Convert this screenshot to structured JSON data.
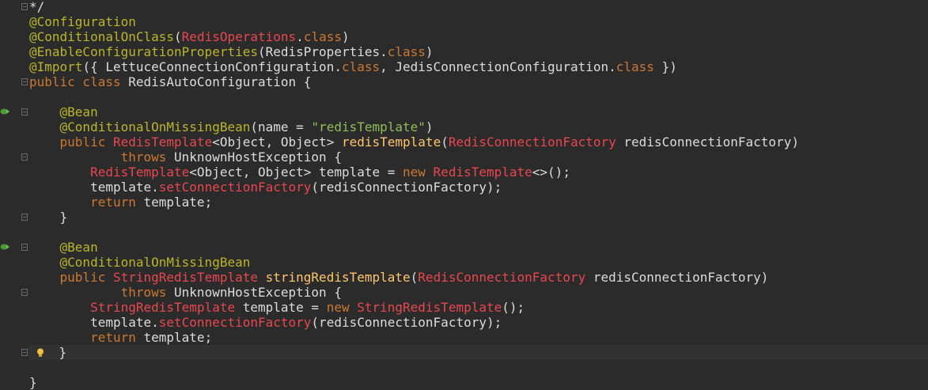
{
  "editor": {
    "lines": [
      {
        "indent": "",
        "tokens": [
          {
            "t": "*/",
            "c": "plain"
          }
        ]
      },
      {
        "indent": "",
        "tokens": [
          {
            "t": "@Configuration",
            "c": "ann"
          }
        ]
      },
      {
        "indent": "",
        "tokens": [
          {
            "t": "@ConditionalOnClass",
            "c": "ann"
          },
          {
            "t": "(",
            "c": "plain"
          },
          {
            "t": "RedisOperations",
            "c": "type"
          },
          {
            "t": ".",
            "c": "plain"
          },
          {
            "t": "class",
            "c": "kw"
          },
          {
            "t": ")",
            "c": "plain"
          }
        ]
      },
      {
        "indent": "",
        "tokens": [
          {
            "t": "@EnableConfigurationProperties",
            "c": "ann"
          },
          {
            "t": "(RedisProperties.",
            "c": "plain"
          },
          {
            "t": "class",
            "c": "kw"
          },
          {
            "t": ")",
            "c": "plain"
          }
        ]
      },
      {
        "indent": "",
        "tokens": [
          {
            "t": "@Import",
            "c": "ann"
          },
          {
            "t": "({ LettuceConnectionConfiguration.",
            "c": "plain"
          },
          {
            "t": "class",
            "c": "kw"
          },
          {
            "t": ", JedisConnectionConfiguration.",
            "c": "plain"
          },
          {
            "t": "class",
            "c": "kw"
          },
          {
            "t": " })",
            "c": "plain"
          }
        ]
      },
      {
        "indent": "",
        "tokens": [
          {
            "t": "public class ",
            "c": "kw"
          },
          {
            "t": "RedisAutoConfiguration {",
            "c": "plain"
          }
        ]
      },
      {
        "indent": "",
        "tokens": []
      },
      {
        "indent": "    ",
        "tokens": [
          {
            "t": "@Bean",
            "c": "ann"
          }
        ]
      },
      {
        "indent": "    ",
        "tokens": [
          {
            "t": "@ConditionalOnMissingBean",
            "c": "ann"
          },
          {
            "t": "(name = ",
            "c": "plain"
          },
          {
            "t": "\"redisTemplate\"",
            "c": "str"
          },
          {
            "t": ")",
            "c": "plain"
          }
        ]
      },
      {
        "indent": "    ",
        "tokens": [
          {
            "t": "public ",
            "c": "kw"
          },
          {
            "t": "RedisTemplate",
            "c": "type"
          },
          {
            "t": "<Object, Object> ",
            "c": "plain"
          },
          {
            "t": "redisTemplate",
            "c": "method"
          },
          {
            "t": "(",
            "c": "plain"
          },
          {
            "t": "RedisConnectionFactory",
            "c": "type"
          },
          {
            "t": " redisConnectionFactory)",
            "c": "plain"
          }
        ]
      },
      {
        "indent": "            ",
        "tokens": [
          {
            "t": "throws ",
            "c": "kw"
          },
          {
            "t": "UnknownHostException {",
            "c": "plain"
          }
        ]
      },
      {
        "indent": "        ",
        "tokens": [
          {
            "t": "RedisTemplate",
            "c": "type"
          },
          {
            "t": "<Object, Object> template = ",
            "c": "plain"
          },
          {
            "t": "new ",
            "c": "kw"
          },
          {
            "t": "RedisTemplate",
            "c": "type"
          },
          {
            "t": "<>();",
            "c": "plain"
          }
        ]
      },
      {
        "indent": "        ",
        "tokens": [
          {
            "t": "template.",
            "c": "plain"
          },
          {
            "t": "setConnectionFactory",
            "c": "type"
          },
          {
            "t": "(redisConnectionFactory);",
            "c": "plain"
          }
        ]
      },
      {
        "indent": "        ",
        "tokens": [
          {
            "t": "return ",
            "c": "kw"
          },
          {
            "t": "template;",
            "c": "plain"
          }
        ]
      },
      {
        "indent": "    ",
        "tokens": [
          {
            "t": "}",
            "c": "plain"
          }
        ]
      },
      {
        "indent": "",
        "tokens": []
      },
      {
        "indent": "    ",
        "tokens": [
          {
            "t": "@Bean",
            "c": "ann"
          }
        ]
      },
      {
        "indent": "    ",
        "tokens": [
          {
            "t": "@ConditionalOnMissingBean",
            "c": "ann"
          }
        ]
      },
      {
        "indent": "    ",
        "tokens": [
          {
            "t": "public ",
            "c": "kw"
          },
          {
            "t": "StringRedisTemplate ",
            "c": "type"
          },
          {
            "t": "stringRedisTemplate",
            "c": "method"
          },
          {
            "t": "(",
            "c": "plain"
          },
          {
            "t": "RedisConnectionFactory",
            "c": "type"
          },
          {
            "t": " redisConnectionFactory)",
            "c": "plain"
          }
        ]
      },
      {
        "indent": "            ",
        "tokens": [
          {
            "t": "throws ",
            "c": "kw"
          },
          {
            "t": "UnknownHostException {",
            "c": "plain"
          }
        ]
      },
      {
        "indent": "        ",
        "tokens": [
          {
            "t": "StringRedisTemplate",
            "c": "type"
          },
          {
            "t": " template = ",
            "c": "plain"
          },
          {
            "t": "new ",
            "c": "kw"
          },
          {
            "t": "StringRedisTemplate",
            "c": "type"
          },
          {
            "t": "();",
            "c": "plain"
          }
        ]
      },
      {
        "indent": "        ",
        "tokens": [
          {
            "t": "template.",
            "c": "plain"
          },
          {
            "t": "setConnectionFactory",
            "c": "type"
          },
          {
            "t": "(redisConnectionFactory);",
            "c": "plain"
          }
        ]
      },
      {
        "indent": "        ",
        "tokens": [
          {
            "t": "return ",
            "c": "kw"
          },
          {
            "t": "template;",
            "c": "plain"
          }
        ]
      },
      {
        "indent": "    ",
        "tokens": [
          {
            "t": "}",
            "c": "plain"
          }
        ]
      },
      {
        "indent": "",
        "tokens": []
      },
      {
        "indent": "",
        "tokens": [
          {
            "t": "}",
            "c": "plain"
          }
        ]
      }
    ],
    "current_line": 23,
    "gutter_icons": [
      {
        "line": 7,
        "icon": "bean-run-icon"
      },
      {
        "line": 16,
        "icon": "bean-run-icon"
      },
      {
        "line": 23,
        "icon": "lightbulb-icon"
      }
    ],
    "colors": {
      "background": "#2b2b2b",
      "annotation": "#bbb529",
      "keyword": "#cc7832",
      "type": "#e8474f",
      "method": "#ffc66d",
      "string": "#8fbc5a",
      "text": "#dcdcdc"
    }
  }
}
